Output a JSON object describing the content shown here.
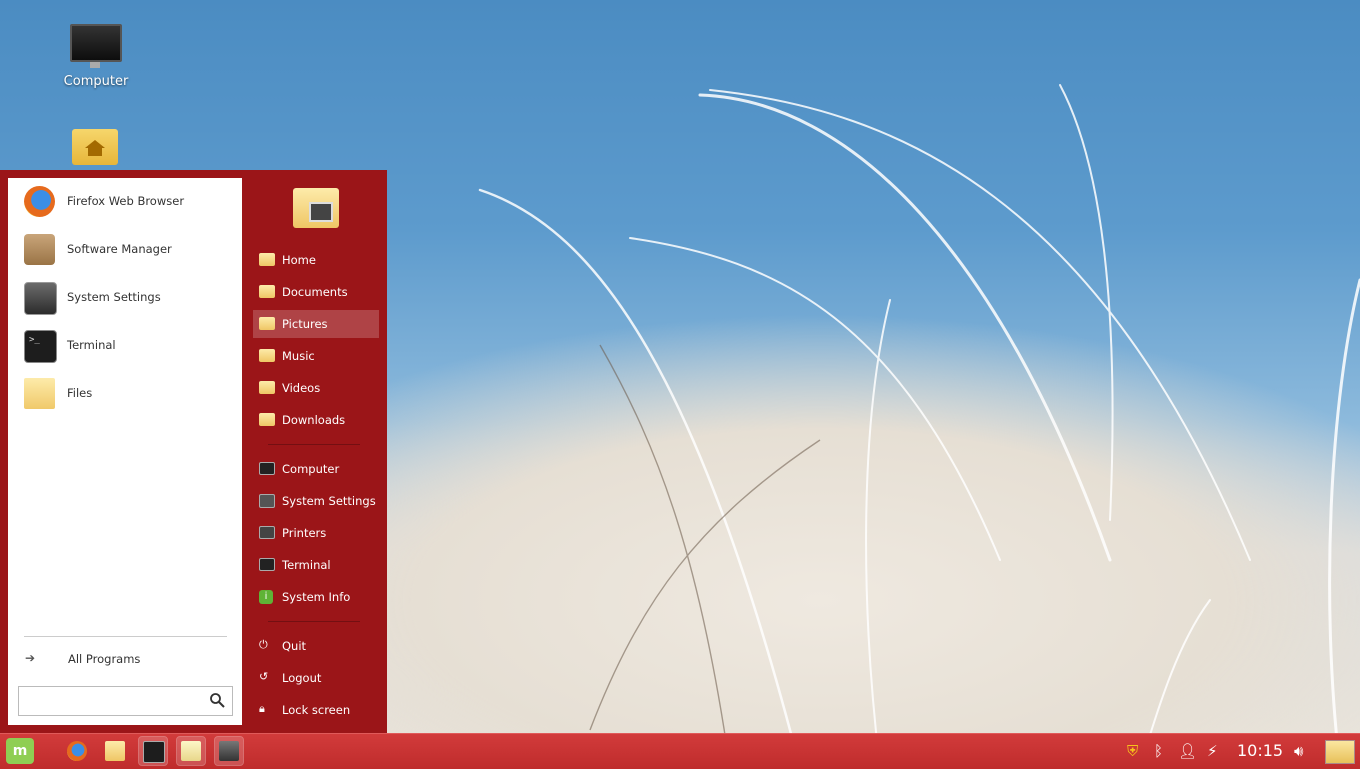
{
  "desktop": {
    "icons": [
      {
        "label": "Computer",
        "icon": "monitor-icon"
      },
      {
        "label": "",
        "icon": "home-folder-icon"
      }
    ]
  },
  "menu": {
    "favorites": [
      {
        "label": "Firefox Web Browser",
        "icon": "firefox-icon"
      },
      {
        "label": "Software Manager",
        "icon": "software-manager-icon"
      },
      {
        "label": "System Settings",
        "icon": "system-settings-icon"
      },
      {
        "label": "Terminal",
        "icon": "terminal-icon"
      },
      {
        "label": "Files",
        "icon": "folder-icon"
      }
    ],
    "all_programs_label": "All Programs",
    "search": {
      "value": "",
      "placeholder": ""
    },
    "places": [
      {
        "label": "Home",
        "icon": "home-folder-icon"
      },
      {
        "label": "Documents",
        "icon": "documents-folder-icon"
      },
      {
        "label": "Pictures",
        "icon": "pictures-folder-icon",
        "highlighted": true
      },
      {
        "label": "Music",
        "icon": "music-folder-icon"
      },
      {
        "label": "Videos",
        "icon": "videos-folder-icon"
      },
      {
        "label": "Downloads",
        "icon": "downloads-folder-icon"
      }
    ],
    "system": [
      {
        "label": "Computer",
        "icon": "computer-icon"
      },
      {
        "label": "System Settings",
        "icon": "settings-icon"
      },
      {
        "label": "Printers",
        "icon": "printer-icon"
      },
      {
        "label": "Terminal",
        "icon": "terminal-icon"
      },
      {
        "label": "System Info",
        "icon": "info-icon"
      }
    ],
    "session": [
      {
        "label": "Quit",
        "icon": "power-icon"
      },
      {
        "label": "Logout",
        "icon": "logout-icon"
      },
      {
        "label": "Lock screen",
        "icon": "lock-icon"
      }
    ]
  },
  "panel": {
    "launchers": [
      "firefox-icon",
      "files-icon",
      "terminal-icon",
      "text-editor-icon",
      "settings-icon"
    ],
    "clock": "10:15",
    "tray": [
      "update-shield-icon",
      "bluetooth-icon",
      "user-icon",
      "network-icon",
      "volume-icon",
      "show-desktop-icon"
    ]
  },
  "colors": {
    "menu_bg": "#9b1518",
    "panel_bg": "#c83333"
  }
}
